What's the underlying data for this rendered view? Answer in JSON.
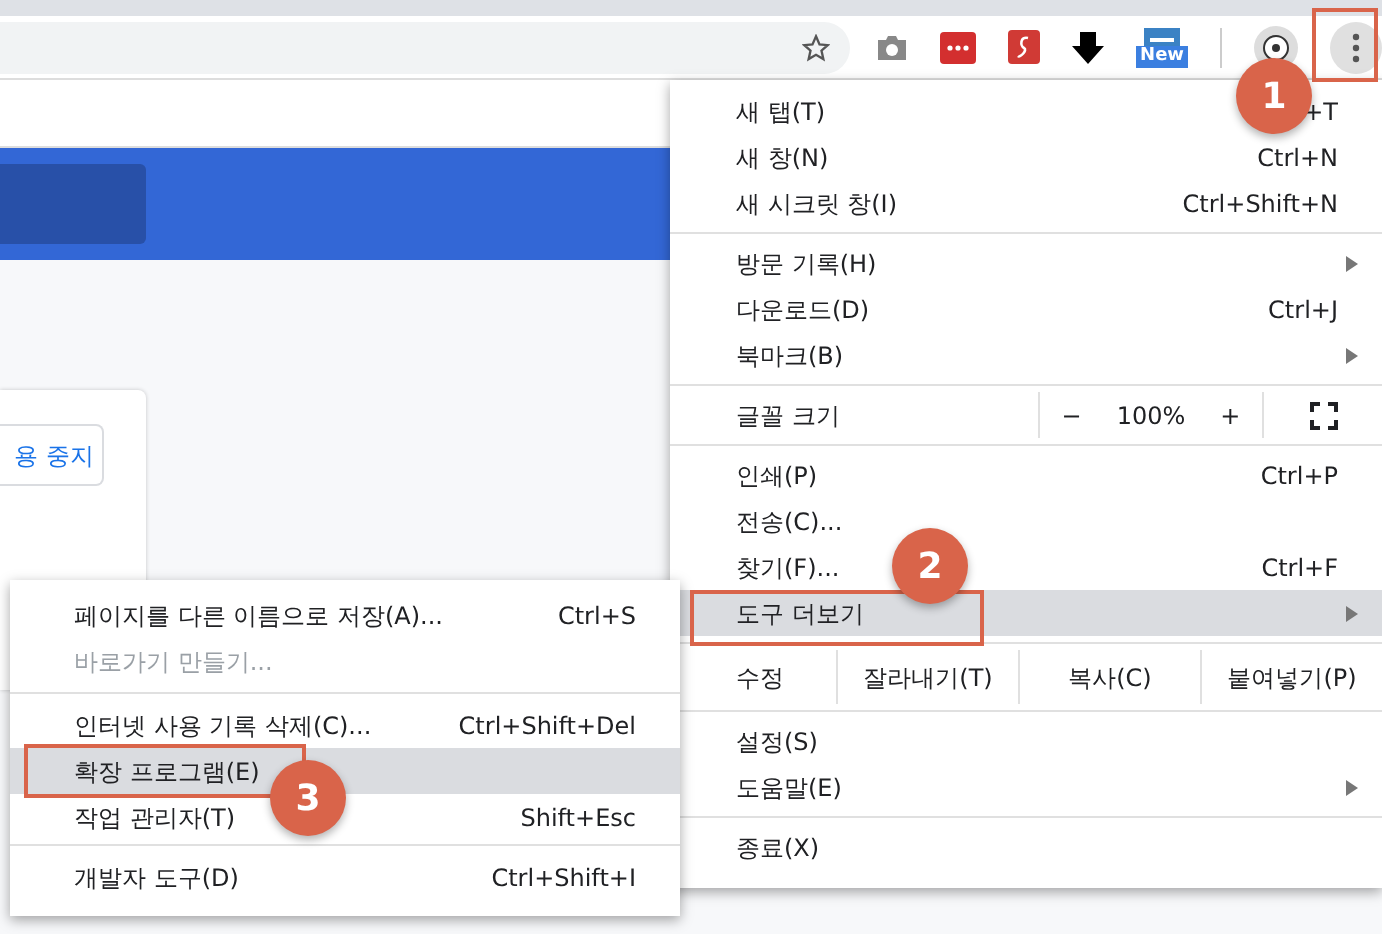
{
  "toolbar": {
    "new_badge": "New"
  },
  "page": {
    "stop_button": "용 중지"
  },
  "menu": {
    "sections": [
      [
        {
          "label": "새 탭(T)",
          "shortcut": "+T",
          "selected": false
        },
        {
          "label": "새 창(N)",
          "shortcut": "Ctrl+N",
          "selected": false
        },
        {
          "label": "새 시크릿 창(I)",
          "shortcut": "Ctrl+Shift+N",
          "selected": false
        }
      ],
      [
        {
          "label": "방문 기록(H)",
          "selected": false,
          "submenu": true
        },
        {
          "label": "다운로드(D)",
          "shortcut": "Ctrl+J",
          "selected": false
        },
        {
          "label": "북마크(B)",
          "selected": false,
          "submenu": true
        }
      ],
      [
        {
          "kind": "zoom",
          "label": "글꼴 크기",
          "minus": "−",
          "value": "100%",
          "plus": "+"
        }
      ],
      [
        {
          "label": "인쇄(P)",
          "shortcut": "Ctrl+P",
          "selected": false
        },
        {
          "label": "전송(C)...",
          "selected": false
        },
        {
          "label": "찾기(F)...",
          "shortcut": "Ctrl+F",
          "selected": false
        },
        {
          "label": "도구 더보기",
          "selected": true,
          "submenu": true
        }
      ],
      [
        {
          "kind": "edit",
          "label": "수정",
          "actions": [
            "잘라내기(T)",
            "복사(C)",
            "붙여넣기(P)"
          ]
        }
      ],
      [
        {
          "label": "설정(S)",
          "selected": false
        },
        {
          "label": "도움말(E)",
          "selected": false,
          "submenu": true
        }
      ],
      [
        {
          "label": "종료(X)",
          "selected": false
        }
      ]
    ]
  },
  "submenu": {
    "sections": [
      [
        {
          "label": "페이지를 다른 이름으로 저장(A)...",
          "shortcut": "Ctrl+S",
          "selected": false,
          "disabled": false
        },
        {
          "label": "바로가기 만들기...",
          "selected": false,
          "disabled": true
        }
      ],
      [
        {
          "label": "인터넷 사용 기록 삭제(C)...",
          "shortcut": "Ctrl+Shift+Del",
          "selected": false,
          "disabled": false
        },
        {
          "label": "확장 프로그램(E)",
          "selected": true,
          "disabled": false
        },
        {
          "label": "작업 관리자(T)",
          "shortcut": "Shift+Esc",
          "selected": false,
          "disabled": false
        }
      ],
      [
        {
          "label": "개발자 도구(D)",
          "shortcut": "Ctrl+Shift+I",
          "selected": false,
          "disabled": false
        }
      ]
    ]
  },
  "step_badges": [
    "1",
    "2",
    "3"
  ]
}
